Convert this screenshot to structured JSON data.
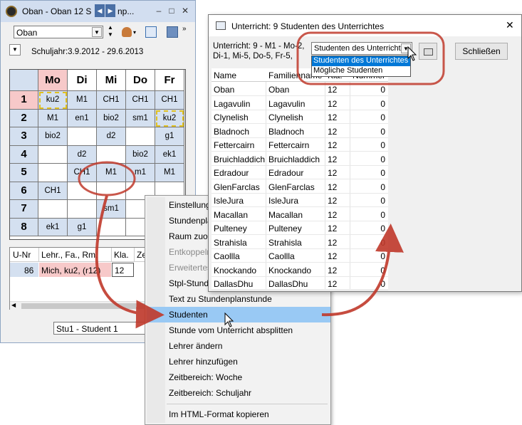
{
  "left_window": {
    "title": "Oban - Oban 12  S",
    "title_tail": "np...",
    "element_combo": "Oban",
    "schoolyear": "Schuljahr:3.9.2012 - 29.6.2013",
    "days": [
      "Mo",
      "Di",
      "Mi",
      "Do",
      "Fr"
    ],
    "periods": [
      "1",
      "2",
      "3",
      "4",
      "5",
      "6",
      "7",
      "8"
    ],
    "cells": [
      [
        "ku2",
        "M1",
        "CH1",
        "CH1",
        "CH1"
      ],
      [
        "M1",
        "en1",
        "bio2",
        "sm1",
        "ku2"
      ],
      [
        "bio2",
        "",
        "d2",
        "",
        "g1"
      ],
      [
        "",
        "d2",
        "",
        "bio2",
        "ek1"
      ],
      [
        "",
        "CH1",
        "M1",
        "m1",
        "M1"
      ],
      [
        "CH1",
        "",
        "",
        "",
        ""
      ],
      [
        "",
        "",
        "sm1",
        "",
        ""
      ],
      [
        "ek1",
        "g1",
        "",
        "",
        ""
      ]
    ],
    "lesson_table": {
      "headers": [
        "U-Nr",
        "Lehr., Fa., Rm.",
        "Kla.",
        "Ze"
      ],
      "row": [
        "86",
        "Mich, ku2, (r12)",
        "12",
        ""
      ]
    },
    "status_combo": "Stu1 - Student 1"
  },
  "context_menu": {
    "items": [
      {
        "label": "Einstellungen",
        "disabled": false,
        "bold": false
      },
      {
        "label": "Stundenplan",
        "disabled": false,
        "bold": false
      },
      {
        "label": "Raum zuordnen",
        "disabled": false,
        "bold": false
      },
      {
        "label": "Entkoppeln",
        "disabled": true,
        "bold": false
      },
      {
        "label": "Erweitertes",
        "disabled": true,
        "bold": false
      },
      {
        "label": "Stpl-Stunde",
        "disabled": false,
        "bold": false
      },
      {
        "label": "Text zu Stundenplanstunde",
        "disabled": false,
        "bold": false
      },
      {
        "label": "Studenten",
        "disabled": false,
        "bold": false
      },
      {
        "label": "Stunde vom Unterricht absplitten",
        "disabled": false,
        "bold": false
      },
      {
        "label": "Lehrer ändern",
        "disabled": false,
        "bold": false
      },
      {
        "label": "Lehrer hinzufügen",
        "disabled": false,
        "bold": false
      },
      {
        "label": "Zeitbereich: Woche",
        "disabled": false,
        "bold": false
      },
      {
        "label": "Zeitbereich: Schuljahr",
        "disabled": false,
        "bold": false
      },
      {
        "label": "Im HTML-Format kopieren",
        "disabled": false,
        "bold": false
      }
    ]
  },
  "dialog": {
    "title": "Unterricht: 9 Studenten des Unterrichtes",
    "info_line1": "Unterricht: 9 - M1 - Mo-2,",
    "info_line2": "Di-1, Mi-5, Do-5, Fr-5,",
    "combo_value": "Studenten des Unterrichtes",
    "combo_options": [
      "Studenten des Unterrichtes",
      "Mögliche Studenten"
    ],
    "close_label": "Schließen",
    "columns": [
      "Name",
      "Familienname",
      "Kla.",
      "Nummer"
    ],
    "rows": [
      [
        "Oban",
        "Oban",
        "12",
        "0"
      ],
      [
        "Lagavulin",
        "Lagavulin",
        "12",
        "0"
      ],
      [
        "Clynelish",
        "Clynelish",
        "12",
        "0"
      ],
      [
        "Bladnoch",
        "Bladnoch",
        "12",
        "0"
      ],
      [
        "Fettercairn",
        "Fettercairn",
        "12",
        "0"
      ],
      [
        "Bruichladdich",
        "Bruichladdich",
        "12",
        "0"
      ],
      [
        "Edradour",
        "Edradour",
        "12",
        "0"
      ],
      [
        "GlenFarclas",
        "GlenFarclas",
        "12",
        "0"
      ],
      [
        "IsleJura",
        "IsleJura",
        "12",
        "0"
      ],
      [
        "Macallan",
        "Macallan",
        "12",
        "0"
      ],
      [
        "Pulteney",
        "Pulteney",
        "12",
        "0"
      ],
      [
        "Strahisla",
        "Strahisla",
        "12",
        "0"
      ],
      [
        "Caollla",
        "Caollla",
        "12",
        "0"
      ],
      [
        "Knockando",
        "Knockando",
        "12",
        "0"
      ],
      [
        "DallasDhu",
        "DallasDhu",
        "12",
        "0"
      ]
    ]
  },
  "colors": {
    "annotation": "#c0392b",
    "selection": "#99c9f4",
    "highlight_cell": "#d4e0f0",
    "pink_cell": "#f7c9c9"
  }
}
